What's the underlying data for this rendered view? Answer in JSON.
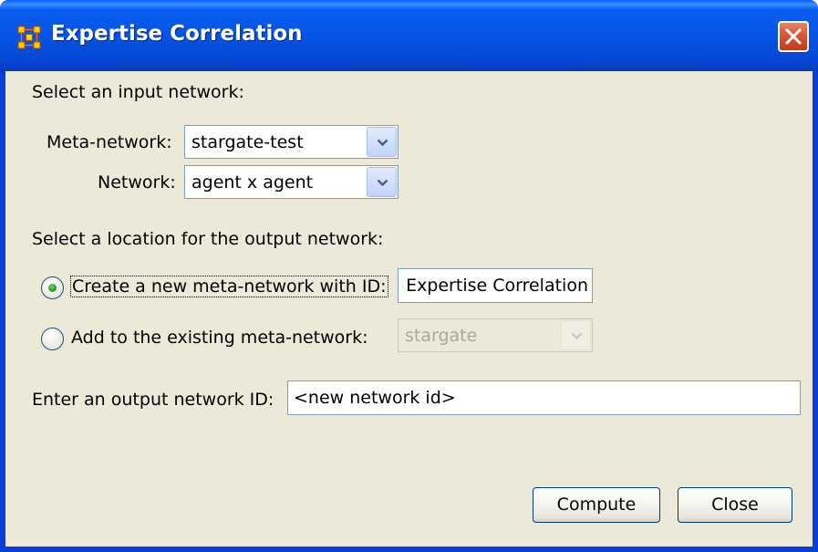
{
  "window": {
    "title": "Expertise Correlation",
    "icon": "network-nodes-icon",
    "close": "close-icon"
  },
  "input_section": {
    "heading": "Select an input network:",
    "meta_network_label": "Meta-network:",
    "meta_network_value": "stargate-test",
    "network_label": "Network:",
    "network_value": "agent x agent"
  },
  "output_section": {
    "heading": "Select a location for the output network:",
    "option_new_label": "Create a new meta-network with ID:",
    "option_new_selected": true,
    "option_new_value": "Expertise Correlation",
    "option_existing_label": "Add to the existing meta-network:",
    "option_existing_selected": false,
    "option_existing_value": "stargate"
  },
  "output_id": {
    "label": "Enter an output network ID:",
    "value": "<new network id>"
  },
  "buttons": {
    "compute": "Compute",
    "close": "Close"
  },
  "colors": {
    "titlebar": "#0654e4",
    "dialog_bg": "#ece9d8",
    "close_button": "#d85a3a",
    "radio_dot": "#21a121"
  }
}
